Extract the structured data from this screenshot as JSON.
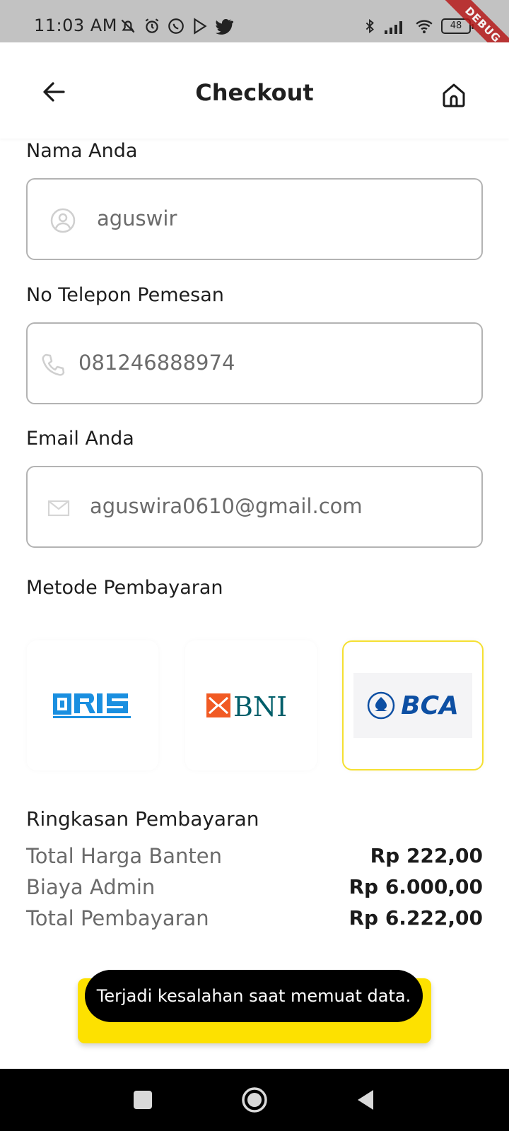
{
  "status_bar": {
    "time": "11:03 AM",
    "battery": "48",
    "debug_label": "DEBUG"
  },
  "app_bar": {
    "title": "Checkout"
  },
  "form": {
    "name": {
      "label": "Nama Anda",
      "value": "aguswir"
    },
    "phone": {
      "label": "No Telepon Pemesan",
      "value": "081246888974"
    },
    "email": {
      "label": "Email Anda",
      "value": "aguswira0610@gmail.com"
    }
  },
  "payment": {
    "label": "Metode Pembayaran",
    "methods": [
      {
        "name": "QRIS",
        "selected": false
      },
      {
        "name": "BNI",
        "selected": false
      },
      {
        "name": "BCA",
        "selected": true
      }
    ]
  },
  "summary": {
    "title": "Ringkasan Pembayaran",
    "rows": [
      {
        "label": "Total Harga Banten",
        "value": "Rp 222,00"
      },
      {
        "label": "Biaya Admin",
        "value": "Rp 6.000,00"
      },
      {
        "label": "Total Pembayaran",
        "value": "Rp 6.222,00"
      }
    ]
  },
  "snackbar": {
    "message": "Terjadi kesalahan saat memuat data."
  },
  "colors": {
    "accent": "#fde100",
    "selected_border": "#f5e032",
    "qris_blue": "#1a8fe0",
    "bni_orange": "#f15a23",
    "bni_teal": "#005e6a",
    "bca_blue": "#0d4fa3"
  }
}
